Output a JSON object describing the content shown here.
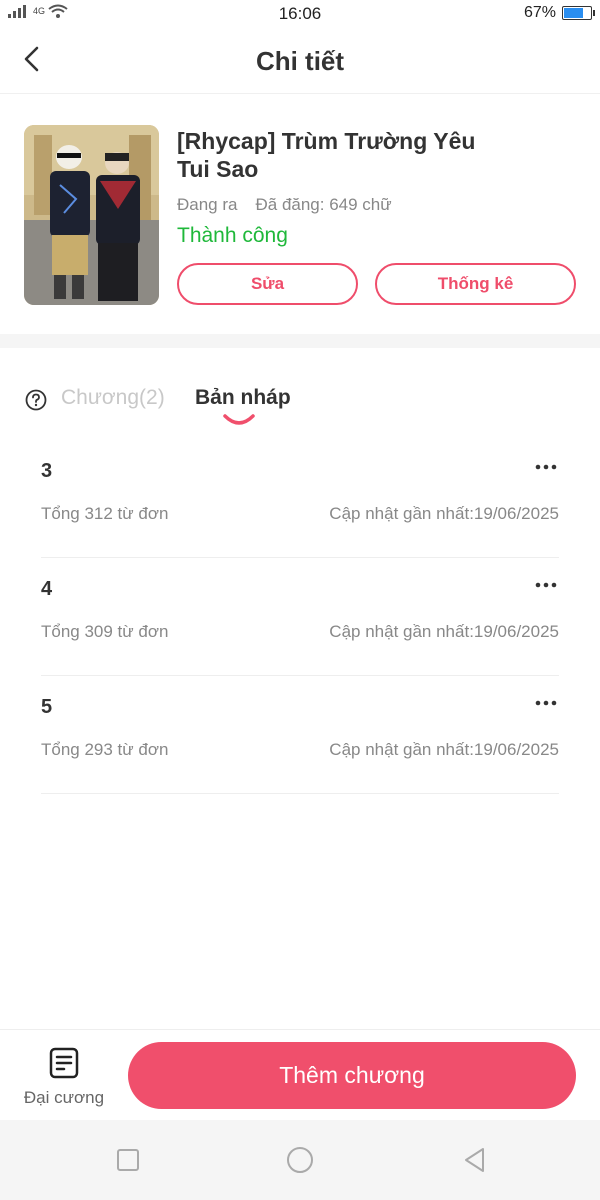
{
  "status_bar": {
    "signal": "4G",
    "time": "16:06",
    "battery": "67%",
    "battery_level": 0.67
  },
  "header": {
    "title": "Chi tiết"
  },
  "book": {
    "title": "[Rhycap] Trùm Trường Yêu Tui Sao",
    "state": "Đang ra",
    "published": "Đã đăng: 649 chữ",
    "review_status": "Thành công",
    "edit_label": "Sửa",
    "stats_label": "Thống kê"
  },
  "tabs": {
    "chapters": "Chương(2)",
    "drafts": "Bản nháp"
  },
  "drafts": [
    {
      "number": "3",
      "words": "Tổng 312 từ đơn",
      "updated": "Cập nhật gần nhất:19/06/2025"
    },
    {
      "number": "4",
      "words": "Tổng 309 từ đơn",
      "updated": "Cập nhật gần nhất:19/06/2025"
    },
    {
      "number": "5",
      "words": "Tổng 293 từ đơn",
      "updated": "Cập nhật gần nhất:19/06/2025"
    }
  ],
  "bottom": {
    "outline_label": "Đại cương",
    "add_chapter_label": "Thêm chương"
  },
  "colors": {
    "accent": "#f04f6c",
    "success": "#1fb83a"
  }
}
